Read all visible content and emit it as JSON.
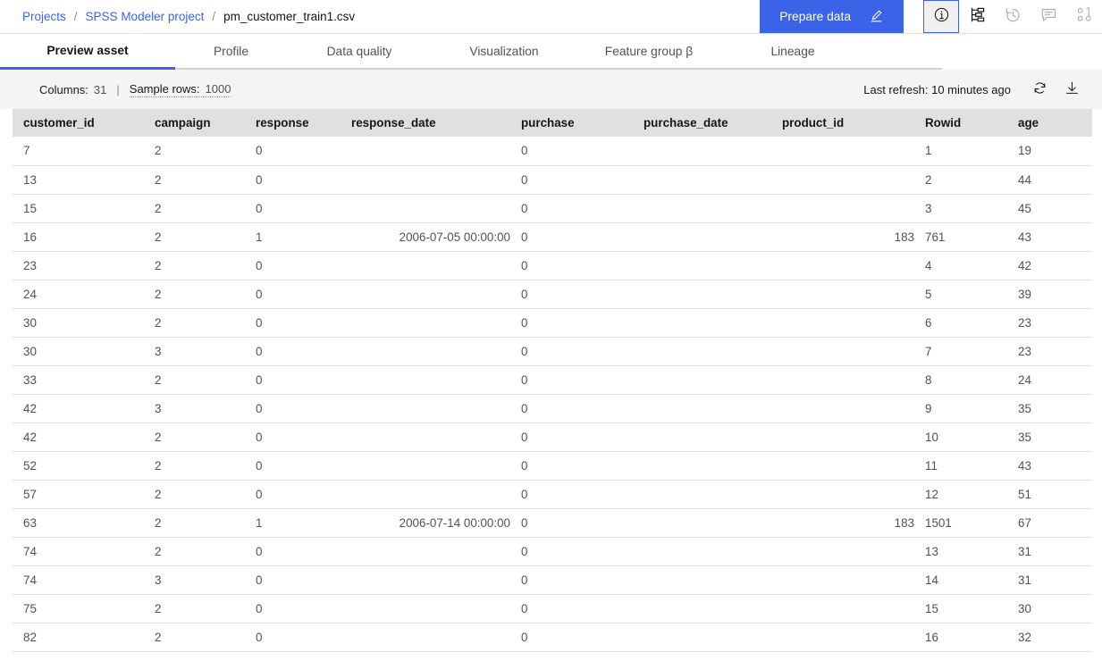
{
  "breadcrumb": {
    "projects": "Projects",
    "project": "SPSS Modeler project",
    "separator": "/",
    "current": "pm_customer_train1.csv"
  },
  "toolbar": {
    "prepare_data_label": "Prepare data",
    "pencil_icon": "pencil-icon",
    "icons": [
      {
        "name": "info-icon",
        "selected": true
      },
      {
        "name": "flow-hierarchy-icon",
        "selected": false
      },
      {
        "name": "history-clock-icon",
        "selected": false
      },
      {
        "name": "comment-icon",
        "selected": false
      },
      {
        "name": "binary-01-icon",
        "selected": false
      }
    ],
    "accent_color": "#3b63e8"
  },
  "tabs": [
    {
      "label": "Preview asset",
      "active": true
    },
    {
      "label": "Profile",
      "active": false
    },
    {
      "label": "Data quality",
      "active": false
    },
    {
      "label": "Visualization",
      "active": false
    },
    {
      "label": "Feature group β",
      "active": false
    },
    {
      "label": "Lineage",
      "active": false
    }
  ],
  "infobar": {
    "columns_label": "Columns:",
    "columns_value": "31",
    "separator": "|",
    "sample_rows_label": "Sample rows:",
    "sample_rows_value": "1000",
    "last_refresh": "Last refresh: 10 minutes ago",
    "refresh_icon": "refresh-icon",
    "download_icon": "download-icon"
  },
  "table": {
    "columns": [
      {
        "key": "customer_id",
        "label": "customer_id",
        "align": "left"
      },
      {
        "key": "campaign",
        "label": "campaign",
        "align": "left"
      },
      {
        "key": "response",
        "label": "response",
        "align": "left"
      },
      {
        "key": "response_date",
        "label": "response_date",
        "align": "right"
      },
      {
        "key": "purchase",
        "label": "purchase",
        "align": "left"
      },
      {
        "key": "purchase_date",
        "label": "purchase_date",
        "align": "left"
      },
      {
        "key": "product_id",
        "label": "product_id",
        "align": "right"
      },
      {
        "key": "Rowid",
        "label": "Rowid",
        "align": "left"
      },
      {
        "key": "age",
        "label": "age",
        "align": "left"
      }
    ],
    "rows": [
      [
        "7",
        "2",
        "0",
        "",
        "0",
        "",
        "",
        "1",
        "19"
      ],
      [
        "13",
        "2",
        "0",
        "",
        "0",
        "",
        "",
        "2",
        "44"
      ],
      [
        "15",
        "2",
        "0",
        "",
        "0",
        "",
        "",
        "3",
        "45"
      ],
      [
        "16",
        "2",
        "1",
        "2006-07-05 00:00:00",
        "0",
        "",
        "183",
        "761",
        "43"
      ],
      [
        "23",
        "2",
        "0",
        "",
        "0",
        "",
        "",
        "4",
        "42"
      ],
      [
        "24",
        "2",
        "0",
        "",
        "0",
        "",
        "",
        "5",
        "39"
      ],
      [
        "30",
        "2",
        "0",
        "",
        "0",
        "",
        "",
        "6",
        "23"
      ],
      [
        "30",
        "3",
        "0",
        "",
        "0",
        "",
        "",
        "7",
        "23"
      ],
      [
        "33",
        "2",
        "0",
        "",
        "0",
        "",
        "",
        "8",
        "24"
      ],
      [
        "42",
        "3",
        "0",
        "",
        "0",
        "",
        "",
        "9",
        "35"
      ],
      [
        "42",
        "2",
        "0",
        "",
        "0",
        "",
        "",
        "10",
        "35"
      ],
      [
        "52",
        "2",
        "0",
        "",
        "0",
        "",
        "",
        "11",
        "43"
      ],
      [
        "57",
        "2",
        "0",
        "",
        "0",
        "",
        "",
        "12",
        "51"
      ],
      [
        "63",
        "2",
        "1",
        "2006-07-14 00:00:00",
        "0",
        "",
        "183",
        "1501",
        "67"
      ],
      [
        "74",
        "2",
        "0",
        "",
        "0",
        "",
        "",
        "13",
        "31"
      ],
      [
        "74",
        "3",
        "0",
        "",
        "0",
        "",
        "",
        "14",
        "31"
      ],
      [
        "75",
        "2",
        "0",
        "",
        "0",
        "",
        "",
        "15",
        "30"
      ],
      [
        "82",
        "2",
        "0",
        "",
        "0",
        "",
        "",
        "16",
        "32"
      ]
    ]
  }
}
